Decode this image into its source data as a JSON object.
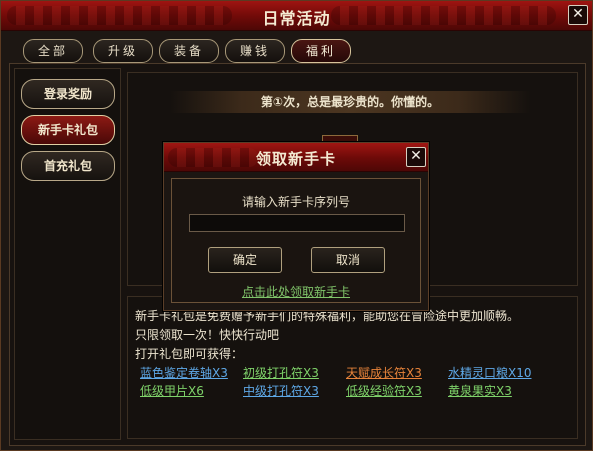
{
  "window": {
    "title": "日常活动",
    "close_label": "✕"
  },
  "tabs": [
    {
      "label": "全部"
    },
    {
      "label": "升级"
    },
    {
      "label": "装备"
    },
    {
      "label": "赚钱"
    },
    {
      "label": "福利",
      "active": true
    }
  ],
  "sidebar": {
    "items": [
      {
        "label": "登录奖励"
      },
      {
        "label": "新手卡礼包",
        "active": true
      },
      {
        "label": "首充礼包"
      }
    ]
  },
  "panel": {
    "banner": "第①次，总是最珍贵的。你懂的。",
    "gift_icon": "gift-box-icon",
    "description_line1": "新手卡礼包是免费赠予新手们的特殊福利，能助您在冒险途中更加顺畅。",
    "description_line2": "只限领取一次！快快行动吧",
    "description_line3": "打开礼包即可获得：",
    "rewards": [
      {
        "label": "蓝色鉴定卷轴X3",
        "color": "#5ea8e6"
      },
      {
        "label": "初级打孔符X3",
        "color": "#7fd36a"
      },
      {
        "label": "天赋成长符X3",
        "color": "#e8843a"
      },
      {
        "label": "水精灵口粮X10",
        "color": "#5ea8e6"
      },
      {
        "label": "低级甲片X6",
        "color": "#7fd36a"
      },
      {
        "label": "中级打孔符X3",
        "color": "#5ea8e6"
      },
      {
        "label": "低级经验符X3",
        "color": "#7fd36a"
      },
      {
        "label": "黄泉果实X3",
        "color": "#7fd36a"
      }
    ]
  },
  "dialog": {
    "title": "领取新手卡",
    "close_label": "✕",
    "prompt": "请输入新手卡序列号",
    "input_value": "",
    "confirm_label": "确定",
    "cancel_label": "取消",
    "link_text": "点击此处领取新手卡"
  },
  "colors": {
    "title_red": "#8a100d",
    "accent_gold": "#c8b48a"
  }
}
